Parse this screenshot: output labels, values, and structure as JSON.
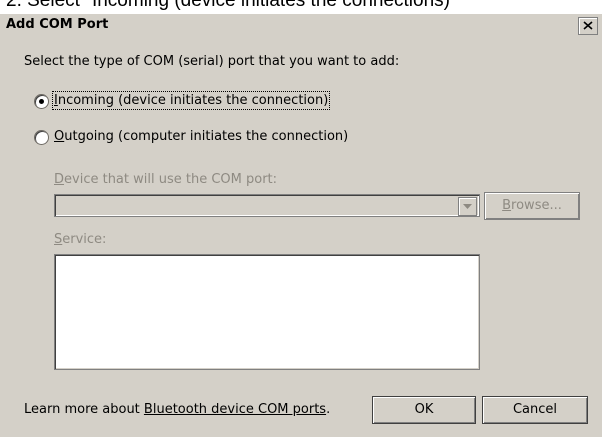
{
  "caption": "2. Select \"Incoming (device initiates the connections)\"",
  "dialog": {
    "title": "Add COM Port",
    "close_symbol": "x",
    "prompt": "Select the type of COM (serial) port that you want to add:",
    "options": [
      {
        "mnemonic": "I",
        "rest": "ncoming (device initiates the connection)",
        "selected": true
      },
      {
        "mnemonic": "O",
        "rest": "utgoing (computer initiates the connection)",
        "selected": false
      }
    ],
    "device_label_mnemonic": "D",
    "device_label_rest": "evice that will use the COM port:",
    "device_value": "",
    "browse_mnemonic": "B",
    "browse_rest": "rowse...",
    "service_label_mnemonic": "S",
    "service_label_rest": "ervice:",
    "learn_more_prefix": "Learn more about ",
    "learn_more_link": "Bluetooth device COM ports",
    "learn_more_suffix": ".",
    "ok_label": "OK",
    "cancel_label": "Cancel"
  }
}
